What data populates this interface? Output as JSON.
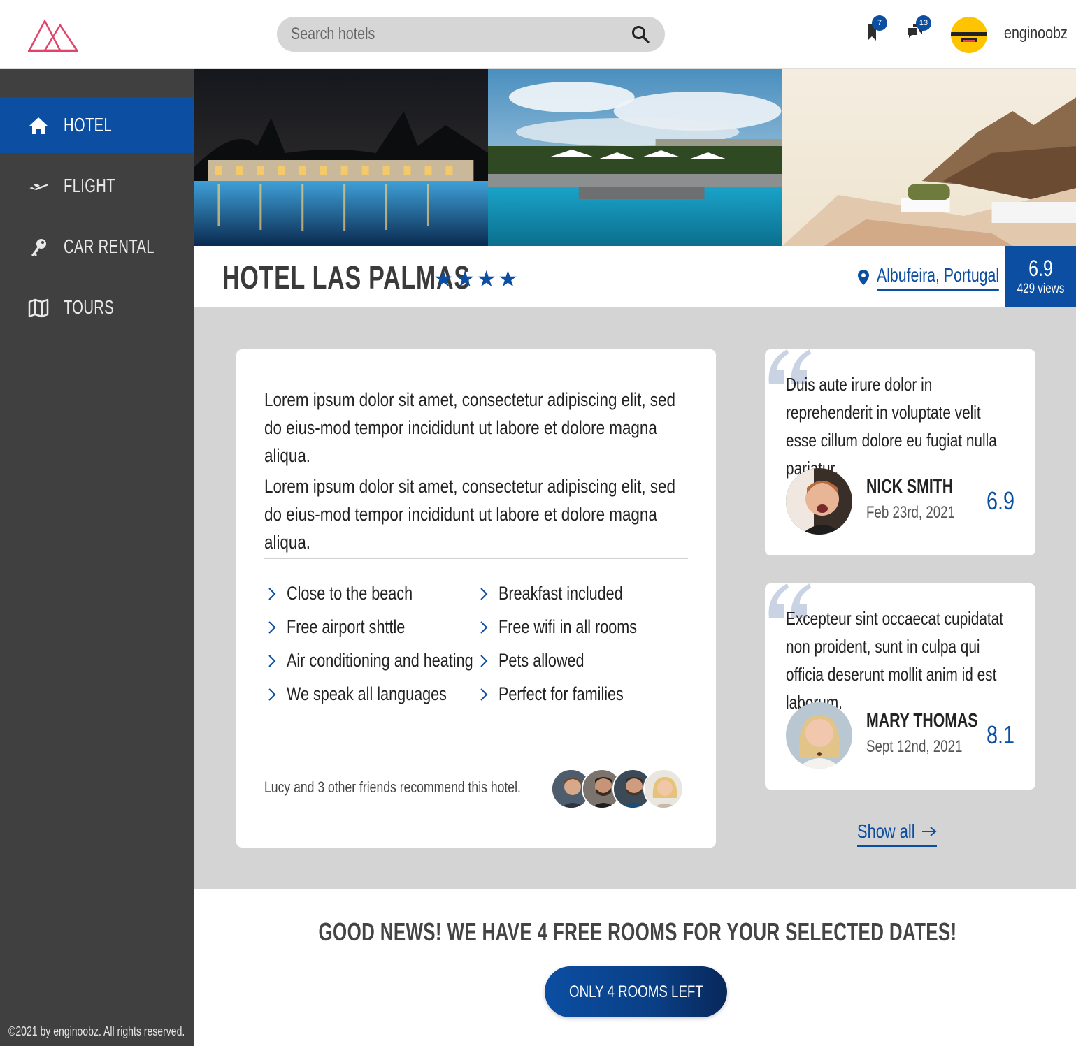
{
  "header": {
    "search_placeholder": "Search hotels",
    "bookmarks_count": "7",
    "messages_count": "13",
    "username": "enginoobz"
  },
  "sidebar": {
    "items": [
      {
        "label": "HOTEL",
        "icon": "home-icon",
        "active": true
      },
      {
        "label": "FLIGHT",
        "icon": "plane-icon",
        "active": false
      },
      {
        "label": "CAR RENTAL",
        "icon": "key-icon",
        "active": false
      },
      {
        "label": "TOURS",
        "icon": "map-icon",
        "active": false
      }
    ],
    "copyright": "©2021 by enginoobz. All rights reserved."
  },
  "hotel": {
    "name": "HOTEL LAS PALMAS",
    "stars": "★★★★",
    "location": "Albufeira, Portugal",
    "score": "6.9",
    "views": "429 views"
  },
  "description": {
    "paragraphs": [
      "Lorem ipsum dolor sit amet, consectetur adipiscing elit, sed do eius-mod tempor incididunt ut labore et dolore magna aliqua.",
      "Lorem ipsum dolor sit amet, consectetur adipiscing elit, sed do eius-mod tempor incididunt ut labore et dolore magna aliqua."
    ],
    "features": [
      "Close to the beach",
      "Free airport shttle",
      "Air conditioning and heating",
      "We speak all languages",
      "Breakfast included",
      "Free wifi in all rooms",
      "Pets allowed",
      "Perfect for families"
    ],
    "friends_text": "Lucy and 3 other friends recommend this hotel."
  },
  "reviews": [
    {
      "text": "Duis aute irure dolor in reprehenderit in voluptate velit esse cillum dolore eu fugiat nulla pariatur.",
      "name": "NICK SMITH",
      "date": "Feb 23rd, 2021",
      "score": "6.9"
    },
    {
      "text": "Excepteur sint occaecat cupidatat non proident, sunt in culpa qui officia deserunt mollit anim id est laborum.",
      "name": "MARY THOMAS",
      "date": "Sept 12nd, 2021",
      "score": "8.1"
    }
  ],
  "show_all": "Show all",
  "availability": {
    "headline": "GOOD NEWS! WE HAVE 4 FREE ROOMS FOR YOUR SELECTED DATES!",
    "cta": "ONLY 4 ROOMS LEFT"
  },
  "colors": {
    "accent": "#0b4ea2",
    "sidebar": "#404040",
    "grey_bg": "#d4d4d4",
    "logo": "#e0446a"
  }
}
